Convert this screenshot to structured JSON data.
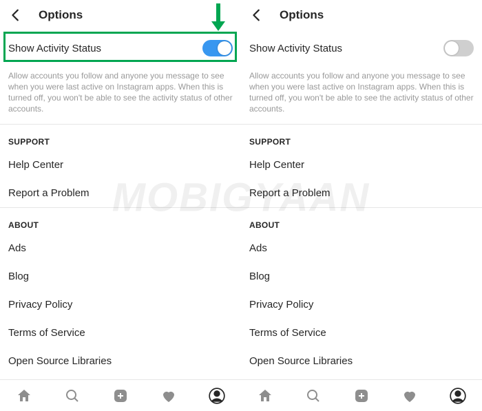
{
  "watermark": "MOBIGYAAN",
  "arrow_color": "#00a651",
  "left": {
    "header": {
      "title": "Options"
    },
    "activity": {
      "label": "Show Activity Status",
      "on": true,
      "desc": "Allow accounts you follow and anyone you message to see when you were last active on Instagram apps. When this is turned off, you won't be able to see the activity status of other accounts."
    },
    "support": {
      "header": "SUPPORT",
      "help": "Help Center",
      "report": "Report a Problem"
    },
    "about": {
      "header": "ABOUT",
      "ads": "Ads",
      "blog": "Blog",
      "privacy": "Privacy Policy",
      "tos": "Terms of Service",
      "oss": "Open Source Libraries"
    }
  },
  "right": {
    "header": {
      "title": "Options"
    },
    "activity": {
      "label": "Show Activity Status",
      "on": false,
      "desc": "Allow accounts you follow and anyone you message to see when you were last active on Instagram apps. When this is turned off, you won't be able to see the activity status of other accounts."
    },
    "support": {
      "header": "SUPPORT",
      "help": "Help Center",
      "report": "Report a Problem"
    },
    "about": {
      "header": "ABOUT",
      "ads": "Ads",
      "blog": "Blog",
      "privacy": "Privacy Policy",
      "tos": "Terms of Service",
      "oss": "Open Source Libraries"
    }
  }
}
